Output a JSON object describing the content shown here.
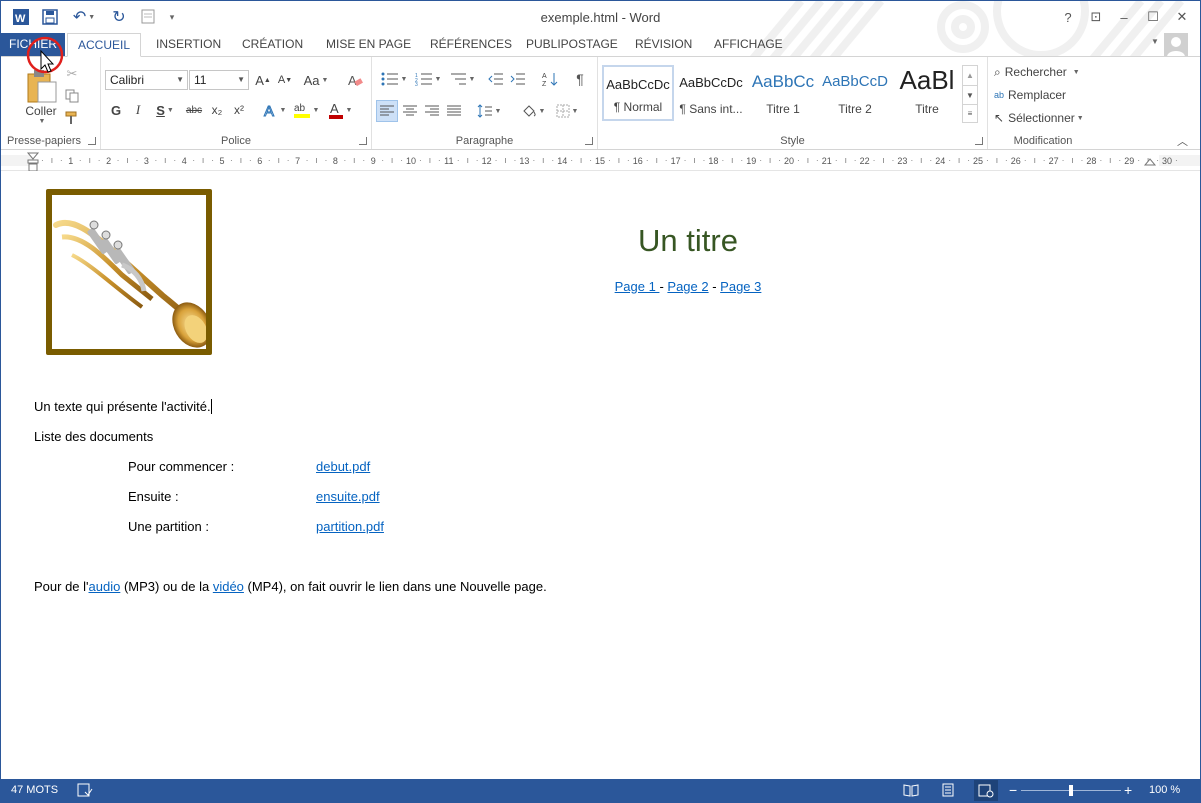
{
  "window": {
    "title": "exemple.html - Word",
    "controls": {
      "help": "?",
      "restore_ribbon": "⊡",
      "minimize": "–",
      "maximize": "☐",
      "close": "✕"
    }
  },
  "tabs": {
    "file": "FICHIER",
    "items": [
      "ACCUEIL",
      "INSERTION",
      "CRÉATION",
      "MISE EN PAGE",
      "RÉFÉRENCES",
      "PUBLIPOSTAGE",
      "RÉVISION",
      "AFFICHAGE"
    ],
    "active": "ACCUEIL"
  },
  "ribbon": {
    "clipboard": {
      "label": "Presse-papiers",
      "paste": "Coller"
    },
    "font": {
      "label": "Police",
      "family": "Calibri",
      "size": "11",
      "bold": "G",
      "italic": "I",
      "underline": "S",
      "strike": "abc",
      "subscript": "x₂",
      "superscript": "x²",
      "grow": "A",
      "shrink": "A",
      "case": "Aa",
      "font_color_hex": "#c00000",
      "highlight_hex": "#ffff00"
    },
    "paragraph": {
      "label": "Paragraphe",
      "pilcrow": "¶"
    },
    "styles": {
      "label": "Style",
      "items": [
        {
          "sample": "AaBbCcDc",
          "name": "¶ Normal"
        },
        {
          "sample": "AaBbCcDc",
          "name": "¶ Sans int..."
        },
        {
          "sample": "AaBbCc",
          "name": "Titre 1"
        },
        {
          "sample": "AaBbCcD",
          "name": "Titre 2"
        },
        {
          "sample": "AaBl",
          "name": "Titre"
        }
      ]
    },
    "editing": {
      "label": "Modification",
      "find": "Rechercher",
      "replace": "Remplacer",
      "select": "Sélectionner"
    }
  },
  "ruler": {
    "numbers": [
      "1",
      "2",
      "3",
      "4",
      "5",
      "6",
      "7",
      "8",
      "9",
      "10",
      "11",
      "12",
      "13",
      "14",
      "15",
      "16",
      "17",
      "18",
      "19",
      "20",
      "21",
      "22",
      "23",
      "24",
      "25",
      "26",
      "27",
      "28",
      "29",
      "30"
    ]
  },
  "document": {
    "title": "Un titre",
    "nav": {
      "page1": "Page 1 ",
      "sep1": " - ",
      "page2": "Page 2",
      "sep2": " - ",
      "page3": "Page 3"
    },
    "intro": "Un texte qui présente l'activité.",
    "list_heading": "Liste des documents",
    "documents": [
      {
        "label": "Pour commencer :",
        "file": "debut.pdf"
      },
      {
        "label": "Ensuite :",
        "file": "ensuite.pdf"
      },
      {
        "label": "Une partition :",
        "file": "partition.pdf"
      }
    ],
    "media": {
      "before": "Pour de l'",
      "audio": "audio",
      "middle": " (MP3) ou de la ",
      "video": "vidéo",
      "after": " (MP4), on fait ouvrir le lien dans une Nouvelle page."
    },
    "colors": {
      "title": "#375623",
      "link": "#0563c1",
      "frame": "#7a5c00"
    }
  },
  "statusbar": {
    "words": "47 MOTS",
    "zoom": "100 %",
    "zoom_level": 1.0
  },
  "colors": {
    "accent": "#2b579a"
  }
}
